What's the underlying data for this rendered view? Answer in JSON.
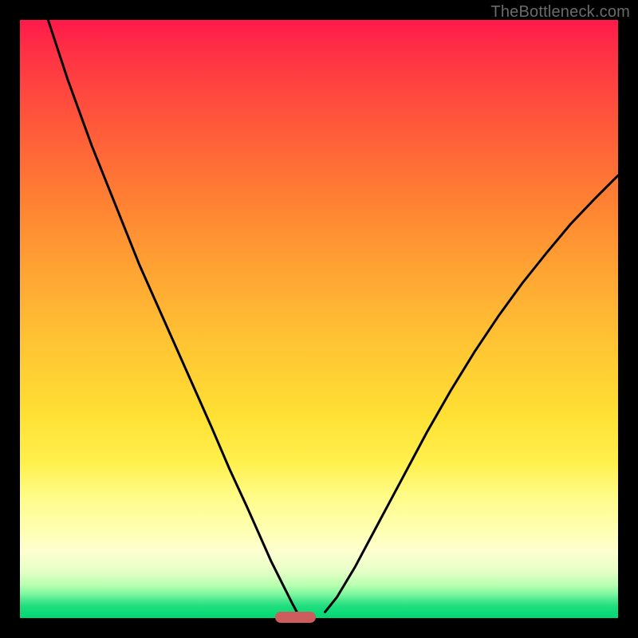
{
  "watermark": "TheBottleneck.com",
  "colors": {
    "background": "#000000",
    "gradient_top": "#ff1a4b",
    "gradient_bottom": "#00d873",
    "curve": "#000000",
    "marker": "#cd5c5c"
  },
  "marker": {
    "x_fraction": 0.46,
    "width_fraction": 0.068
  },
  "chart_data": {
    "type": "line",
    "title": "",
    "xlabel": "",
    "ylabel": "",
    "xlim": [
      0,
      1
    ],
    "ylim": [
      0,
      1
    ],
    "grid": false,
    "legend": false,
    "annotations": [
      "TheBottleneck.com"
    ],
    "notes": "Background is a vertical red→orange→yellow→green gradient. Two black curves descend from the top toward a common minimum near x≈0.46 at y≈0; the left branch starts near the upper-left corner and is steeper, the right branch starts near the upper-right area and is shallower. A small salmon-colored rounded bar sits on the x-axis at the minimum.",
    "series": [
      {
        "name": "left-branch",
        "x": [
          0.047,
          0.08,
          0.12,
          0.16,
          0.2,
          0.24,
          0.28,
          0.32,
          0.35,
          0.38,
          0.4,
          0.42,
          0.44,
          0.455,
          0.463
        ],
        "y": [
          1.0,
          0.9,
          0.79,
          0.69,
          0.59,
          0.5,
          0.41,
          0.32,
          0.25,
          0.185,
          0.14,
          0.095,
          0.055,
          0.025,
          0.01
        ]
      },
      {
        "name": "right-branch",
        "x": [
          0.51,
          0.53,
          0.56,
          0.6,
          0.64,
          0.68,
          0.72,
          0.76,
          0.8,
          0.84,
          0.88,
          0.92,
          0.96,
          1.0
        ],
        "y": [
          0.01,
          0.035,
          0.085,
          0.16,
          0.235,
          0.31,
          0.38,
          0.445,
          0.505,
          0.56,
          0.61,
          0.658,
          0.7,
          0.74
        ]
      }
    ]
  }
}
